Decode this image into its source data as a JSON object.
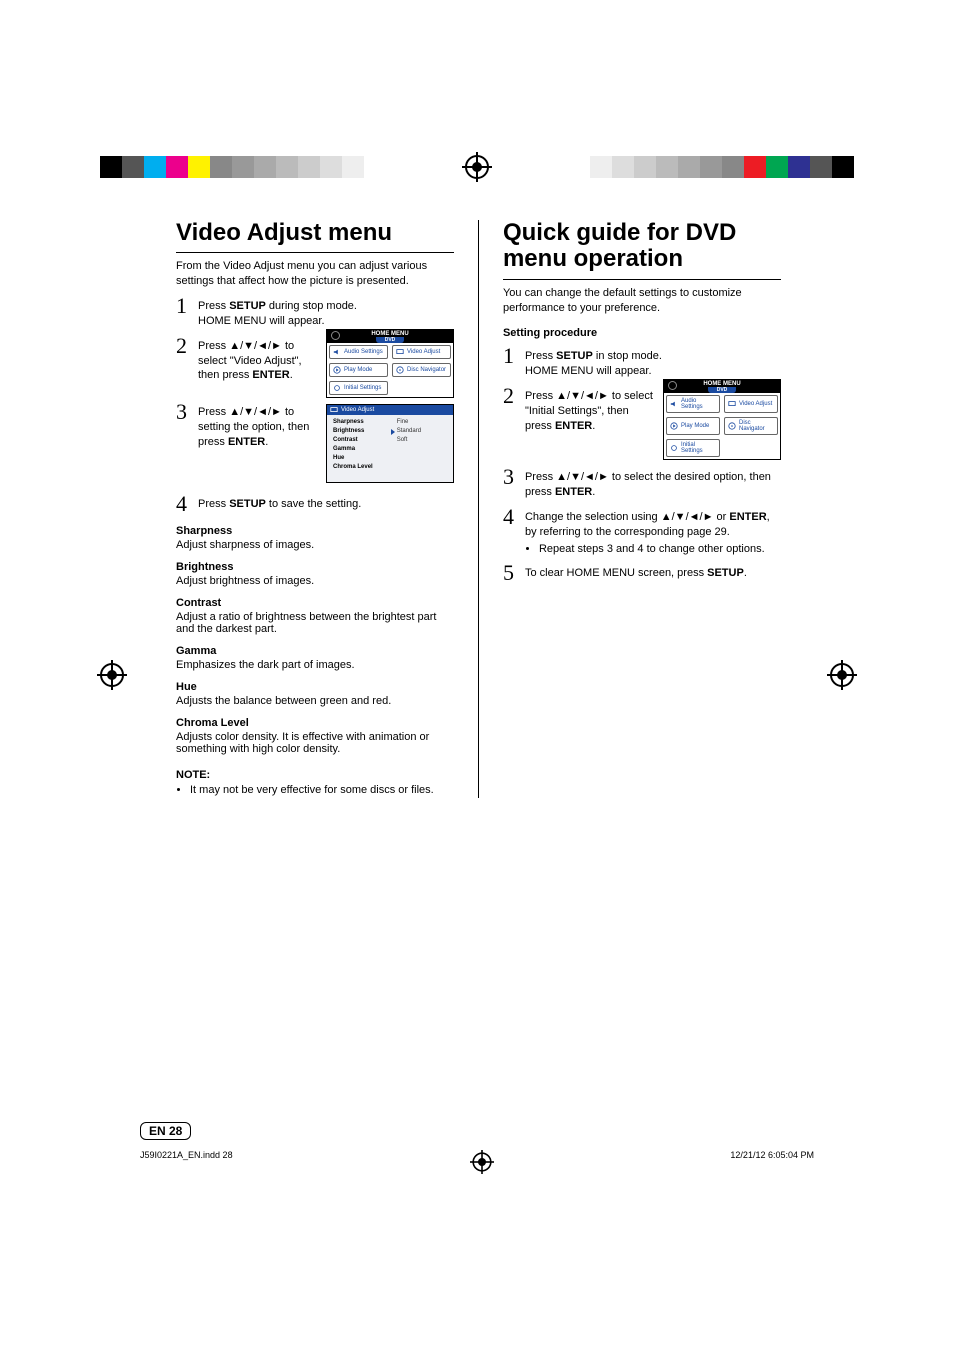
{
  "left": {
    "title": "Video Adjust menu",
    "intro": "From the Video Adjust menu you can adjust various settings that affect how the picture is presented.",
    "steps": {
      "s1a": "Press ",
      "s1b": "SETUP",
      "s1c": " during stop mode.",
      "s1d": "HOME MENU will appear.",
      "s2a": "Press ",
      "s2arr": "▲/▼/◄/►",
      "s2b": " to select \"Video Adjust\", then press ",
      "s2c": "ENTER",
      "s2d": ".",
      "s3a": "Press ",
      "s3arr": "▲/▼/◄/►",
      "s3b": " to setting the option, then press ",
      "s3c": "ENTER",
      "s3d": ".",
      "s4a": "Press ",
      "s4b": "SETUP",
      "s4c": " to save the setting."
    },
    "terms": [
      {
        "t": "Sharpness",
        "d": "Adjust sharpness of images."
      },
      {
        "t": "Brightness",
        "d": "Adjust brightness of images."
      },
      {
        "t": "Contrast",
        "d": "Adjust a ratio of brightness between the brightest part and the darkest part."
      },
      {
        "t": "Gamma",
        "d": "Emphasizes the dark part of images."
      },
      {
        "t": "Hue",
        "d": "Adjusts the balance between green and red."
      },
      {
        "t": "Chroma Level",
        "d": "Adjusts color density. It is effective with animation or something with high color density."
      }
    ],
    "note_h": "NOTE:",
    "note_b": "It may not be very effective for some discs or files."
  },
  "right": {
    "title": "Quick guide for DVD menu operation",
    "intro": "You can change the default settings to customize performance to your preference.",
    "sub_h": "Setting procedure",
    "steps": {
      "s1a": "Press ",
      "s1b": "SETUP",
      "s1c": " in stop mode.",
      "s1d": "HOME MENU will appear.",
      "s2a": "Press ",
      "s2arr": "▲/▼/◄/►",
      "s2b": " to select \"Initial Settings\", then press ",
      "s2c": "ENTER",
      "s2d": ".",
      "s3a": "Press ",
      "s3arr": "▲/▼/◄/►",
      "s3b": " to select the desired option, then press ",
      "s3c": "ENTER",
      "s3d": ".",
      "s4a": "Change the selection using ",
      "s4arr": "▲/▼/◄/►",
      "s4b": " or ",
      "s4c": "ENTER",
      "s4d": ", by referring to the corresponding page 29.",
      "s4e": "Repeat steps 3 and 4 to change other options.",
      "s5a": "To clear HOME MENU screen, press ",
      "s5b": "SETUP",
      "s5c": "."
    }
  },
  "menu": {
    "title": "HOME MENU",
    "sub": "DVD",
    "items": [
      "Audio Settings",
      "Video Adjust",
      "Play Mode",
      "Disc Navigator",
      "Initial Settings"
    ]
  },
  "va": {
    "title": "Video Adjust",
    "list": [
      "Sharpness",
      "Brightness",
      "Contrast",
      "Gamma",
      "Hue",
      "Chroma Level"
    ],
    "opts": [
      "Fine",
      "Standard",
      "Soft"
    ]
  },
  "page_num": "EN 28",
  "footer": {
    "left": "J59I0221A_EN.indd   28",
    "right": "12/21/12   6:05:04 PM"
  }
}
